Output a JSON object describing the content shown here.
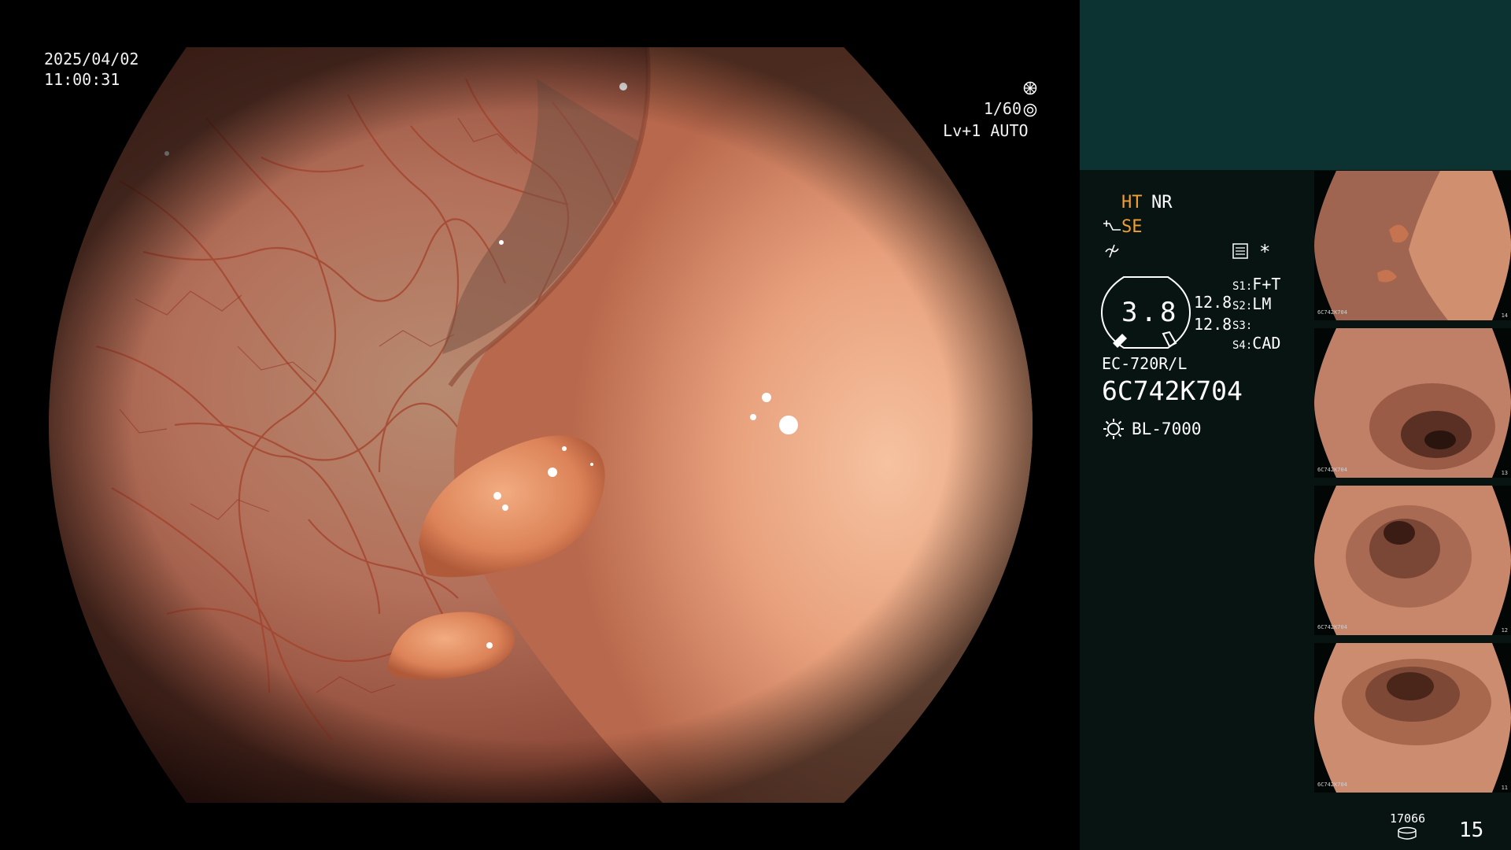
{
  "overlay": {
    "date": "2025/04/02",
    "time": "11:00:31",
    "shutter": "1/60",
    "level": "Lv+1",
    "mode": "AUTO"
  },
  "panel": {
    "ht": "HT",
    "nr": "NR",
    "se": "SE",
    "zoom_value": "3.8",
    "ratio_1": "12.8",
    "ratio_2": "12.8",
    "s1_key": "S1:",
    "s1_val": "F+T",
    "s2_key": "S2:",
    "s2_val": "LM",
    "s3_key": "S3:",
    "s3_val": "",
    "s4_key": "S4:",
    "s4_val": "CAD",
    "scope_model": "EC-720R/L",
    "scope_serial": "6C742K704",
    "light_source": "BL-7000",
    "record_count": "17066",
    "page_number": "15"
  },
  "thumbnails": [
    {
      "label": "6C742K704",
      "num": "14"
    },
    {
      "label": "6C742K704",
      "num": "13"
    },
    {
      "label": "6C742K704",
      "num": "12"
    },
    {
      "label": "6C742K704",
      "num": "11"
    }
  ],
  "colors": {
    "mucosa": "#b9715a",
    "vessel": "#a23a26",
    "fold": "#e69c78",
    "polyp": "#e89066",
    "panel_bg": "#071412",
    "panel_top": "#0c3232",
    "accent_orange": "#f0a030"
  },
  "icons": [
    "aperture-icon",
    "iris-icon",
    "scope-tip-icon",
    "no-signal-icon",
    "settings-list-icon",
    "asterisk-icon",
    "light-source-icon",
    "database-icon"
  ]
}
